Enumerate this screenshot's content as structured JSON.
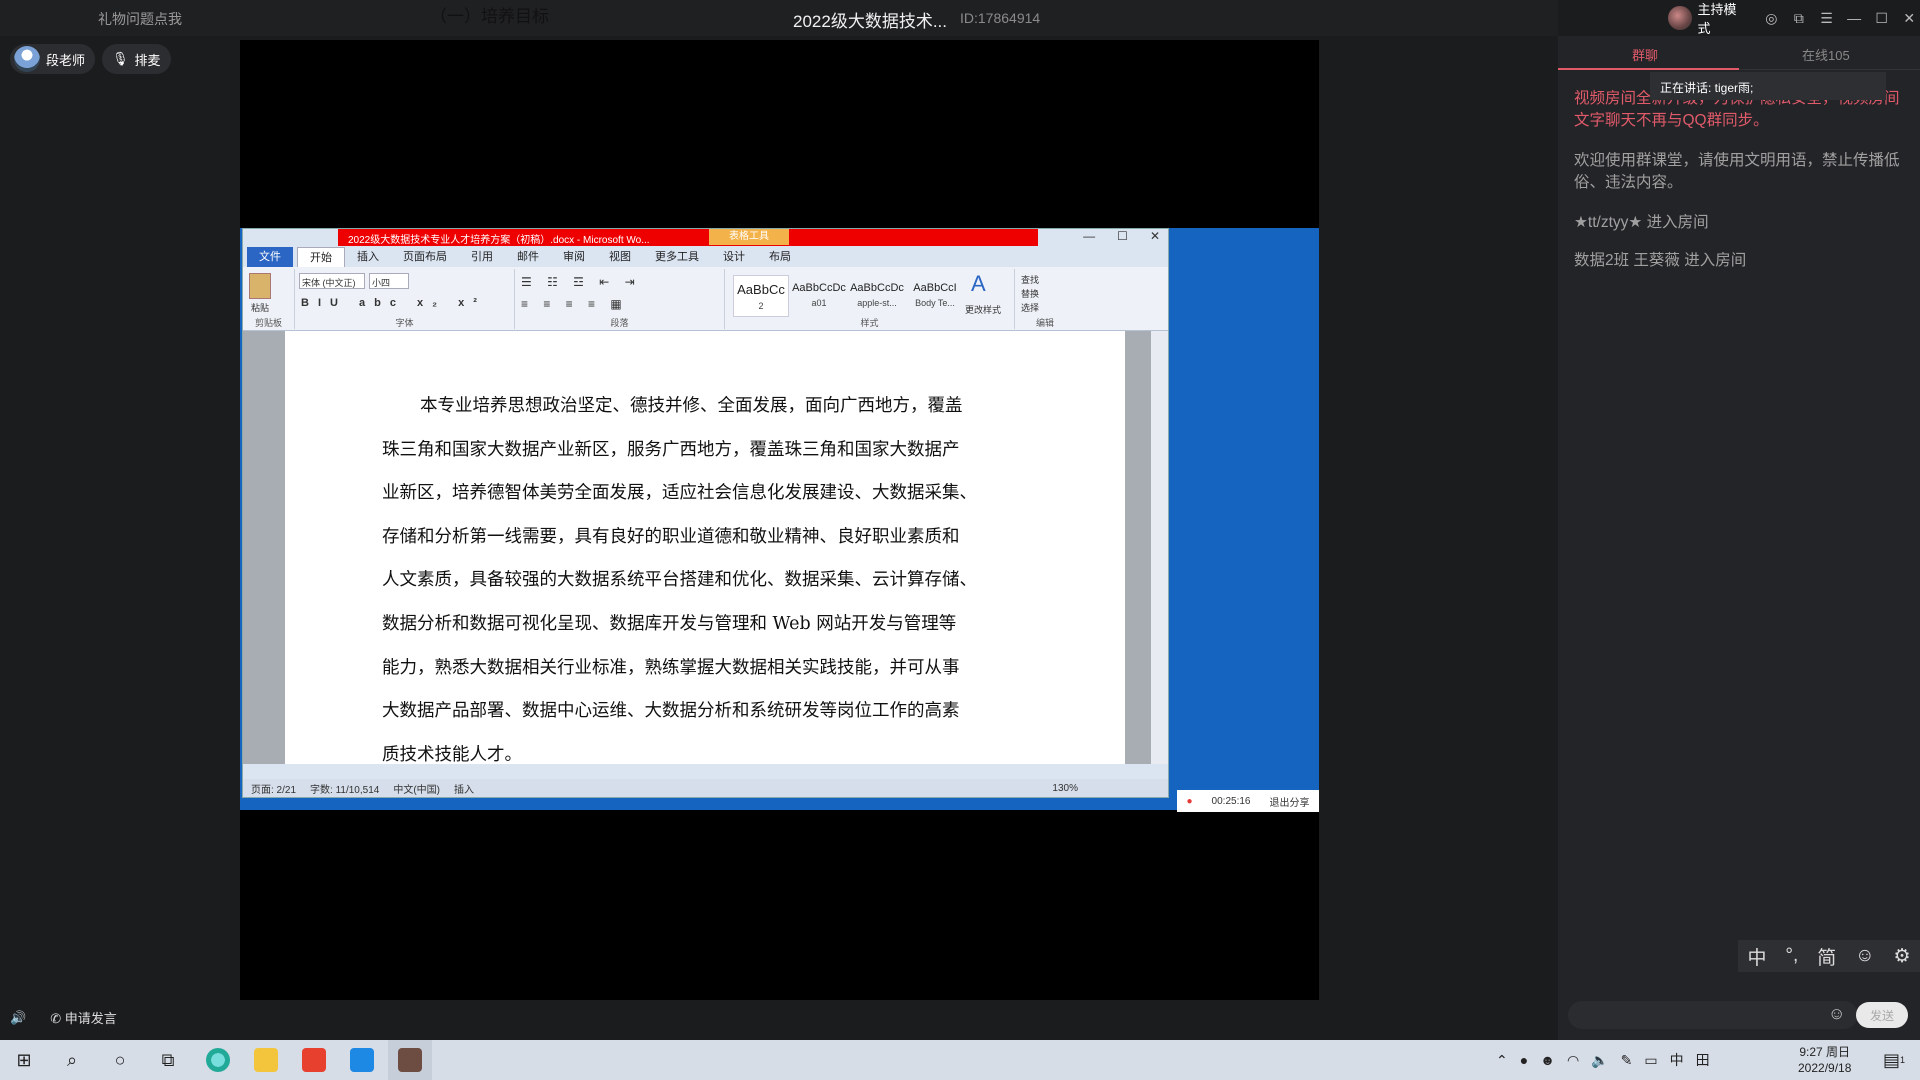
{
  "topbar": {
    "gift_label": "礼物问题点我",
    "room_title": "2022级大数据技术...",
    "room_id": "ID:17864914",
    "host_mode": "主持模式"
  },
  "teacher": {
    "name": "段老师",
    "rank_label": "排麦"
  },
  "word": {
    "doc_title": "2022级大数据技术专业人才培养方案（初稿）.docx - Microsoft Wo...",
    "table_tools": "表格工具",
    "tabs": [
      "文件",
      "开始",
      "插入",
      "页面布局",
      "引用",
      "邮件",
      "审阅",
      "视图",
      "更多工具",
      "设计",
      "布局"
    ],
    "font_name": "宋体 (中文正)",
    "font_size": "小四",
    "paste_label": "粘贴",
    "group_labels": [
      "剪贴板",
      "字体",
      "段落",
      "样式",
      "编辑"
    ],
    "styles": [
      {
        "preview": "AaBbCc",
        "name": "2"
      },
      {
        "preview": "AaBbCcDc",
        "name": "a01"
      },
      {
        "preview": "AaBbCcDc",
        "name": "apple-st..."
      },
      {
        "preview": "AaBbCcI",
        "name": "Body Te..."
      }
    ],
    "change_styles": "更改样式",
    "edit_items": [
      "查找",
      "替换",
      "选择"
    ],
    "heading": "（一）培养目标",
    "body_lines": [
      "本专业培养思想政治坚定、德技并修、全面发展，面向广西地方，覆盖",
      "珠三角和国家大数据产业新区，服务广西地方，覆盖珠三角和国家大数据产",
      "业新区，培养德智体美劳全面发展，适应社会信息化发展建设、大数据采集、",
      "存储和分析第一线需要，具有良好的职业道德和敬业精神、良好职业素质和",
      "人文素质，具备较强的大数据系统平台搭建和优化、数据采集、云计算存储、",
      "数据分析和数据可视化呈现、数据库开发与管理和 Web 网站开发与管理等",
      "能力，熟悉大数据相关行业标准，熟练掌握大数据相关实践技能，并可从事",
      "大数据产品部署、数据中心运维、大数据分析和系统研发等岗位工作的高素",
      "质技术技能人才。"
    ],
    "status": {
      "page": "页面: 2/21",
      "words": "字数: 11/10,514",
      "lang": "中文(中国)",
      "mode": "插入",
      "zoom": "130%"
    }
  },
  "share": {
    "timer": "00:25:16",
    "exit_label": "退出分享"
  },
  "panel": {
    "tab_group": "群聊",
    "tab_online": "在线105",
    "speaking": "正在讲话: tiger雨;",
    "messages": [
      {
        "text": "视频房间全新升级，为保护隐私安全，视频房间文字聊天不再与QQ群同步。",
        "color": "red"
      },
      {
        "text": "欢迎使用群课堂，请使用文明用语，禁止传播低俗、违法内容。",
        "color": "gray"
      },
      {
        "text": "★tt/ztyy★ 进入房间",
        "color": "gray"
      },
      {
        "text": "数据2班 王葵薇 进入房间",
        "color": "gray"
      }
    ],
    "ime": [
      "中",
      "°,",
      "简",
      "☺",
      "⚙"
    ],
    "send_label": "发送"
  },
  "bottom": {
    "apply_speak": "申请发言"
  },
  "taskbar": {
    "time": "9:27 周日",
    "date": "2022/9/18",
    "tray_lang": "中",
    "notification_count": "1"
  }
}
